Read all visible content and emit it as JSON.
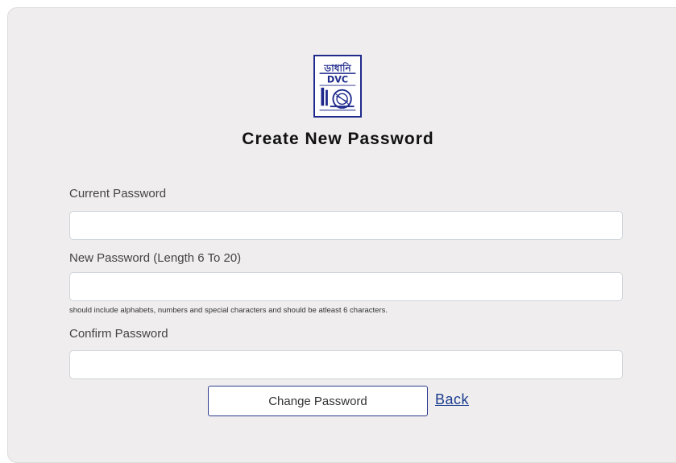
{
  "logo": {
    "text_top": "ডাধানি",
    "text_bottom": "DVC"
  },
  "page_title": "Create New Password",
  "form": {
    "current_password": {
      "label": "Current Password",
      "value": "",
      "placeholder": ""
    },
    "new_password": {
      "label": "New Password (Length 6 To 20)",
      "value": "",
      "placeholder": "",
      "hint": "should include alphabets, numbers and special characters and should be atleast 6 characters."
    },
    "confirm_password": {
      "label": "Confirm Password",
      "value": "",
      "placeholder": ""
    },
    "submit_label": "Change Password",
    "back_label": "Back"
  },
  "colors": {
    "card_background": "#efeded",
    "brand_blue": "#1f2a8c",
    "link_blue": "#1a3c8f"
  }
}
